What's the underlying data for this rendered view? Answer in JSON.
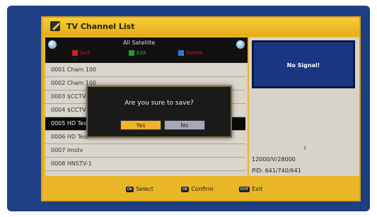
{
  "window": {
    "title": "TV Channel List"
  },
  "list": {
    "satellite": "All Satellite",
    "keys": [
      {
        "color": "#d12020",
        "label": "Sort"
      },
      {
        "color": "#1f9d2a",
        "label": "Edit"
      },
      {
        "color": "#2a7bd8",
        "label": "Delete"
      }
    ],
    "channels": [
      "0001 Cham 100",
      "0002 Cham 100",
      "0003 $CCTV-5",
      "0004 $CCTV-5",
      "0005 HD Test",
      "0006 HD Test",
      "0007 Imstv",
      "0008 HNSTV-1"
    ],
    "selected_index": 4
  },
  "preview": {
    "status": "No Signal!",
    "info_line1": "l",
    "info_line2": "12000/V/28000",
    "info_line3": "PID: 641/740/641"
  },
  "dialog": {
    "message": "Are you sure to save?",
    "yes_label": "Yes",
    "no_label": "No"
  },
  "footer": {
    "hints": [
      {
        "key": "OK",
        "label": "Select"
      },
      {
        "key": "OK",
        "label": "Confirm"
      },
      {
        "key": "EXIT",
        "label": "Exit"
      }
    ]
  },
  "colors": {
    "frame_gold": "#e9b627",
    "screen_blue": "#1e3f86",
    "selected_row": "#0a0a0a",
    "yes_button": "#f0b32a"
  }
}
